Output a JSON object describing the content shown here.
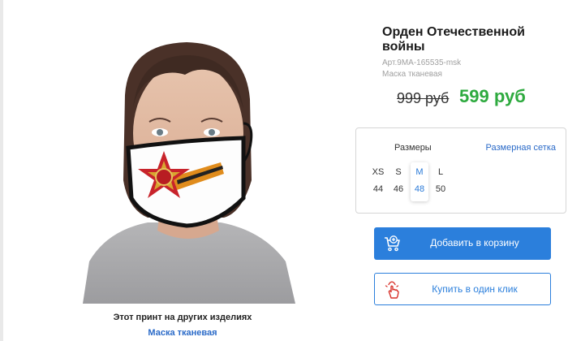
{
  "product": {
    "title": "Орден Отечественной войны",
    "sku": "Арт.9МА-165535-msk",
    "category": "Маска тканевая",
    "old_price": "999 руб",
    "new_price": "599 руб"
  },
  "sizes": {
    "label": "Размеры",
    "chart_link": "Размерная сетка",
    "options": [
      {
        "letter": "XS",
        "number": "44"
      },
      {
        "letter": "S",
        "number": "46"
      },
      {
        "letter": "M",
        "number": "48"
      },
      {
        "letter": "L",
        "number": "50"
      }
    ],
    "selected": "M"
  },
  "actions": {
    "add_to_cart": "Добавить в корзину",
    "buy_one_click": "Купить в один клик"
  },
  "other_items": {
    "heading": "Этот принт на других изделиях",
    "link": "Маска тканевая"
  },
  "colors": {
    "accent": "#2b7fdc",
    "price_green": "#2eaa3f"
  }
}
